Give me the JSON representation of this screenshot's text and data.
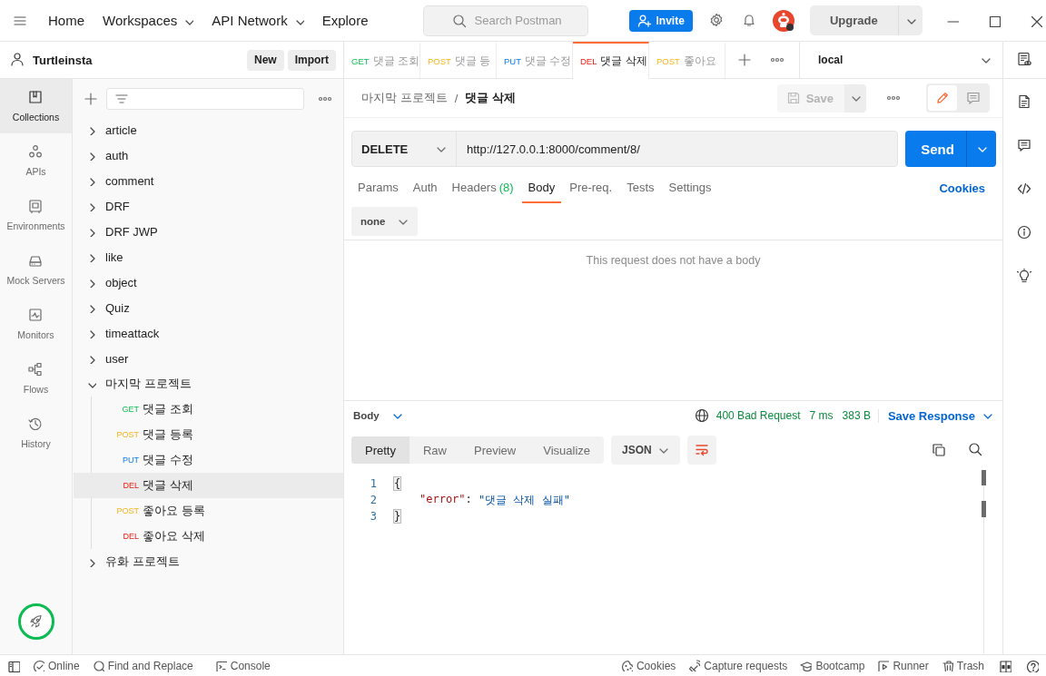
{
  "topbar": {
    "nav": [
      {
        "label": "Home",
        "dropdown": false
      },
      {
        "label": "Workspaces",
        "dropdown": true
      },
      {
        "label": "API Network",
        "dropdown": true
      },
      {
        "label": "Explore",
        "dropdown": false
      }
    ],
    "search": {
      "placeholder": "Search Postman"
    },
    "invite": "Invite",
    "upgrade": "Upgrade"
  },
  "workspace": {
    "name": "Turtleinsta",
    "buttons": [
      "New",
      "Import"
    ]
  },
  "sidebar_nav": [
    {
      "label": "Collections",
      "selected": true
    },
    {
      "label": "APIs",
      "selected": false
    },
    {
      "label": "Environments",
      "selected": false
    },
    {
      "label": "Mock Servers",
      "selected": false
    },
    {
      "label": "Monitors",
      "selected": false
    },
    {
      "label": "Flows",
      "selected": false
    },
    {
      "label": "History",
      "selected": false
    }
  ],
  "collections": [
    {
      "name": "article",
      "expanded": false
    },
    {
      "name": "auth",
      "expanded": false
    },
    {
      "name": "comment",
      "expanded": false
    },
    {
      "name": "DRF",
      "expanded": false
    },
    {
      "name": "DRF JWP",
      "expanded": false
    },
    {
      "name": "like",
      "expanded": false
    },
    {
      "name": "object",
      "expanded": false
    },
    {
      "name": "Quiz",
      "expanded": false
    },
    {
      "name": "timeattack",
      "expanded": false
    },
    {
      "name": "user",
      "expanded": false
    },
    {
      "name": "마지막 프로젝트",
      "expanded": true,
      "children": [
        {
          "method": "GET",
          "name": "댓글 조회",
          "selected": false
        },
        {
          "method": "POST",
          "name": "댓글 등록",
          "selected": false
        },
        {
          "method": "PUT",
          "name": "댓글 수정",
          "selected": false
        },
        {
          "method": "DEL",
          "name": "댓글 삭제",
          "selected": true
        },
        {
          "method": "POST",
          "name": "좋아요 등록",
          "selected": false
        },
        {
          "method": "DEL",
          "name": "좋아요 삭제",
          "selected": false
        }
      ]
    },
    {
      "name": "유화 프로젝트",
      "expanded": false
    }
  ],
  "tabs": [
    {
      "method": "GET",
      "label": "댓글 조회",
      "selected": false
    },
    {
      "method": "POST",
      "label": "댓글 등",
      "selected": false
    },
    {
      "method": "PUT",
      "label": "댓글 수정",
      "selected": false
    },
    {
      "method": "DEL",
      "label": "댓글 삭제",
      "selected": true
    },
    {
      "method": "POST",
      "label": "좋아요",
      "selected": false
    }
  ],
  "environment": "local",
  "breadcrumb": [
    "마지막 프로젝트",
    "/",
    "댓글 삭제"
  ],
  "save": {
    "label": "Save",
    "disabled": true
  },
  "modes": [
    {
      "kind": "edit",
      "selected": true
    },
    {
      "kind": "comments",
      "selected": false
    }
  ],
  "request": {
    "method": "DELETE",
    "url": "http://127.0.0.1:8000/comment/8/",
    "send": "Send"
  },
  "request_tabs": [
    {
      "label": "Params",
      "selected": false
    },
    {
      "label": "Auth",
      "selected": false
    },
    {
      "label": "Headers",
      "count": "(8)",
      "selected": false
    },
    {
      "label": "Body",
      "selected": true
    },
    {
      "label": "Pre-req.",
      "selected": false
    },
    {
      "label": "Tests",
      "selected": false
    },
    {
      "label": "Settings",
      "selected": false
    }
  ],
  "cookies_link": "Cookies",
  "body_type": "none",
  "body_message": "This request does not have a body",
  "response": {
    "section": "Body",
    "status": "400 Bad Request",
    "time": "7 ms",
    "size": "383 B",
    "save_response": "Save Response",
    "views": [
      {
        "label": "Pretty",
        "selected": true
      },
      {
        "label": "Raw",
        "selected": false
      },
      {
        "label": "Preview",
        "selected": false
      },
      {
        "label": "Visualize",
        "selected": false
      }
    ],
    "format": "JSON",
    "lines": [
      {
        "number": "1",
        "tokens": [
          {
            "kind": "bracket",
            "text": "{"
          }
        ]
      },
      {
        "number": "2",
        "tokens": [
          {
            "kind": "key",
            "text": "\"error\""
          },
          {
            "kind": "punct",
            "text": ": "
          },
          {
            "kind": "string",
            "text": "\"댓글 삭제 실패\""
          }
        ]
      },
      {
        "number": "3",
        "tokens": [
          {
            "kind": "bracket",
            "text": "}"
          }
        ]
      }
    ]
  },
  "status_bar": {
    "left": [
      "Online",
      "Find and Replace",
      "Console"
    ],
    "right": [
      "Cookies",
      "Capture requests",
      "Bootcamp",
      "Runner",
      "Trash"
    ]
  }
}
